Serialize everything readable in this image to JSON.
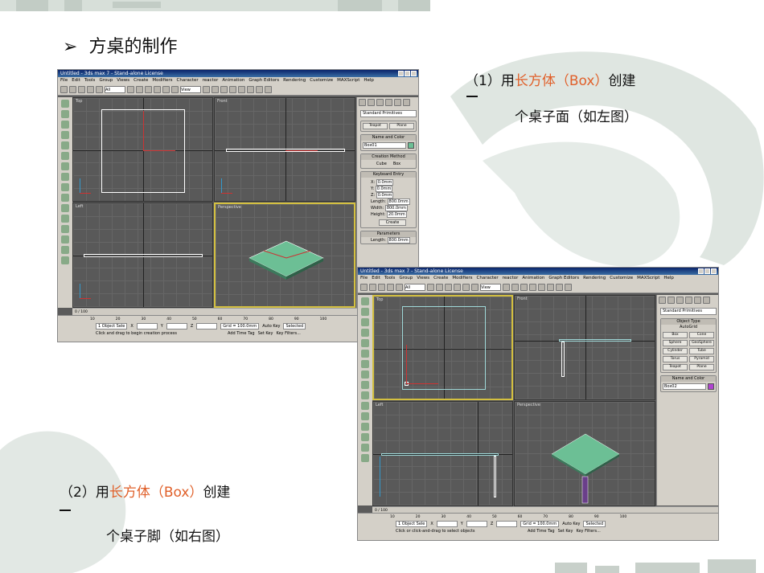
{
  "slide": {
    "title": "方桌的制作",
    "bullet": "➢",
    "step1": {
      "prefix": "（1）用",
      "highlight": "长方体（Box）",
      "suffix": "创建",
      "dash": "一",
      "line2": "个桌子面（如左图）"
    },
    "step2": {
      "prefix": "（2）用",
      "highlight": "长方体（Box）",
      "suffix": "创建",
      "dash": "一",
      "line2": "个桌子脚（如右图）"
    }
  },
  "screenshot1": {
    "window_title": "Untitled - 3ds max 7 - Stand-alone License",
    "menus": [
      "File",
      "Edit",
      "Tools",
      "Group",
      "Views",
      "Create",
      "Modifiers",
      "Character",
      "reactor",
      "Animation",
      "Graph Editors",
      "Rendering",
      "Customize",
      "MAXScript",
      "Help"
    ],
    "toolbar_select": "All",
    "toolbar_view": "View",
    "viewports": [
      "Top",
      "Front",
      "Left",
      "Perspective"
    ],
    "panel": {
      "dropdown": "Standard Primitives",
      "buttons": [
        "Teapot",
        "Plane"
      ],
      "name_color_header": "Name and Color",
      "name_value": "Box01",
      "creation_header": "Creation Method",
      "creation_options": [
        "Cube",
        "Box"
      ],
      "keyboard_header": "Keyboard Entry",
      "kb_fields": [
        {
          "label": "X:",
          "value": "0.0mm"
        },
        {
          "label": "Y:",
          "value": "0.0mm"
        },
        {
          "label": "Z:",
          "value": "0.0mm"
        },
        {
          "label": "Length:",
          "value": "800.0mm"
        },
        {
          "label": "Width:",
          "value": "800.0mm"
        },
        {
          "label": "Height:",
          "value": "20.0mm"
        }
      ],
      "create_button": "Create",
      "params_header": "Parameters",
      "length_label": "Length:",
      "length_value": "800.0mm"
    },
    "timeline": "0 / 100",
    "status_selected": "1 Object Sele",
    "grid": "Grid = 100.0mm",
    "autokey": "Auto Key",
    "selected_dropdown": "Selected",
    "setkey": "Set Key",
    "keyfilters": "Key Filters...",
    "prompt": "Click and drag to begin creation process",
    "add_time_tag": "Add Time Tag",
    "x_label": "X",
    "y_label": "Y",
    "z_label": "Z",
    "ticks": [
      "10",
      "20",
      "30",
      "40",
      "50",
      "60",
      "70",
      "80",
      "90",
      "100"
    ]
  },
  "screenshot2": {
    "window_title": "Untitled - 3ds max 7 - Stand-alone License",
    "menus": [
      "File",
      "Edit",
      "Tools",
      "Group",
      "Views",
      "Create",
      "Modifiers",
      "Character",
      "reactor",
      "Animation",
      "Graph Editors",
      "Rendering",
      "Customize",
      "MAXScript",
      "Help"
    ],
    "toolbar_select": "All",
    "toolbar_view": "View",
    "viewports": [
      "Top",
      "Front",
      "Left",
      "Perspective"
    ],
    "panel": {
      "dropdown": "Standard Primitives",
      "object_type_header": "Object Type",
      "autogrid": "AutoGrid",
      "buttons": [
        "Box",
        "Cone",
        "Sphere",
        "GeoSphere",
        "Cylinder",
        "Tube",
        "Torus",
        "Pyramid",
        "Teapot",
        "Plane"
      ],
      "name_color_header": "Name and Color",
      "name_value": "Box02"
    },
    "timeline": "0 / 100",
    "status_selected": "1 Object Sele",
    "grid": "Grid = 100.0mm",
    "autokey": "Auto Key",
    "selected_dropdown": "Selected",
    "setkey": "Set Key",
    "keyfilters": "Key Filters...",
    "prompt": "Click or click-and-drag to select objects",
    "add_time_tag": "Add Time Tag",
    "x_label": "X",
    "y_label": "Y",
    "z_label": "Z",
    "ticks": [
      "10",
      "20",
      "30",
      "40",
      "50",
      "60",
      "70",
      "80",
      "90",
      "100"
    ]
  },
  "colors": {
    "highlight": "#e0602a",
    "table_green": "#6cbf95",
    "selection_white": "#ffffff",
    "active_viewport": "#d4c040"
  }
}
